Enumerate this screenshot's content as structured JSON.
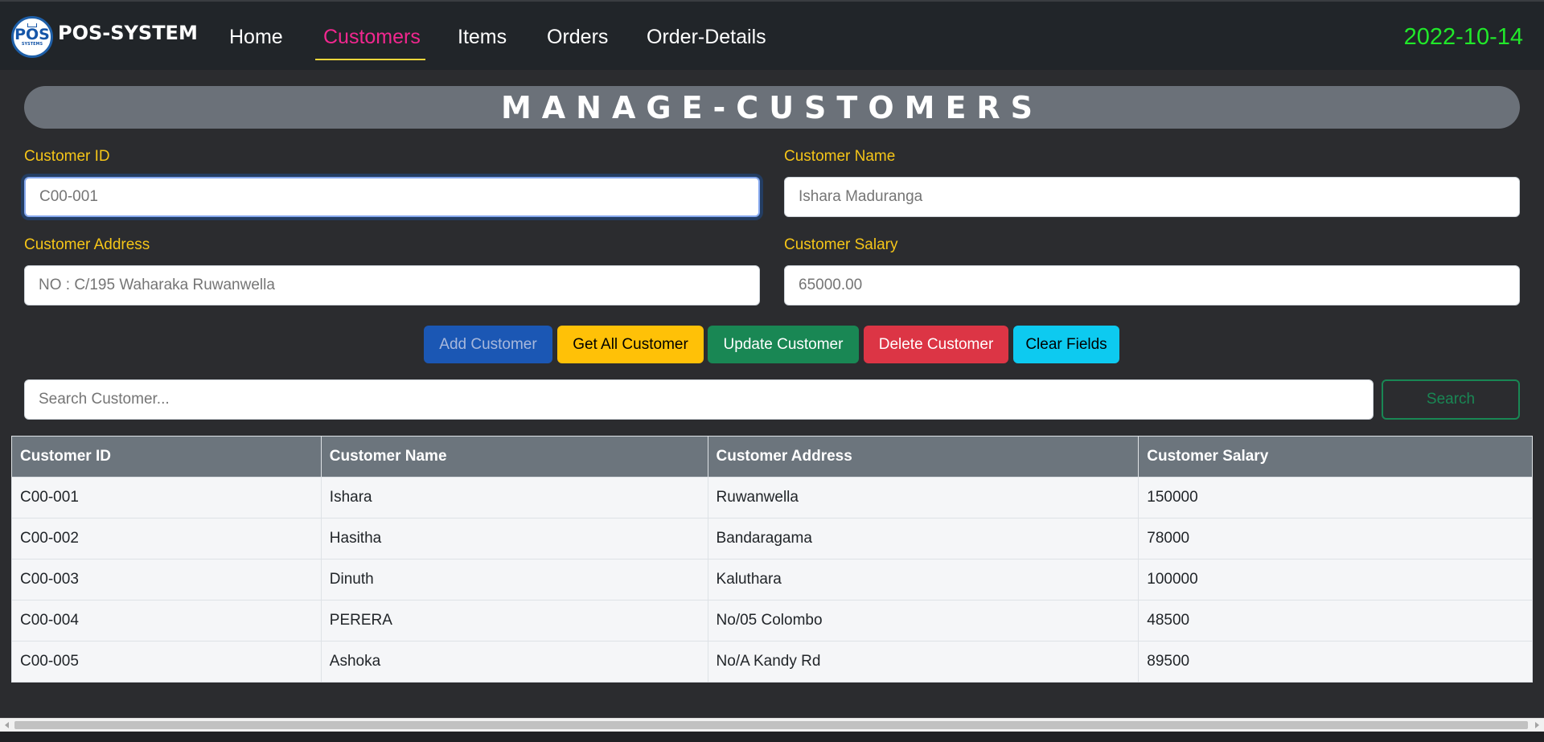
{
  "navbar": {
    "logo": {
      "text": "POS",
      "subtext": "SYSTEMS",
      "icon": "pos-logo-icon"
    },
    "brand": "POS-SYSTEM",
    "links": [
      "Home",
      "Customers",
      "Items",
      "Orders",
      "Order-Details"
    ],
    "active_link": "Customers",
    "date": "2022-10-14"
  },
  "title": "MANAGE-CUSTOMERS",
  "form": {
    "customer_id": {
      "label": "Customer ID",
      "placeholder": "C00-001"
    },
    "customer_name": {
      "label": "Customer Name",
      "placeholder": "Ishara Maduranga"
    },
    "customer_address": {
      "label": "Customer Address",
      "placeholder": "NO : C/195 Waharaka Ruwanwella"
    },
    "customer_salary": {
      "label": "Customer Salary",
      "placeholder": "65000.00"
    }
  },
  "buttons": {
    "add": "Add Customer",
    "get_all": "Get All Customer",
    "update": "Update Customer",
    "delete": "Delete Customer",
    "clear": "Clear Fields"
  },
  "search": {
    "placeholder": "Search Customer...",
    "button": "Search"
  },
  "table": {
    "headers": [
      "Customer ID",
      "Customer Name",
      "Customer Address",
      "Customer Salary"
    ],
    "rows": [
      [
        "C00-001",
        "Ishara",
        "Ruwanwella",
        "150000"
      ],
      [
        "C00-002",
        "Hasitha",
        "Bandaragama",
        "78000"
      ],
      [
        "C00-003",
        "Dinuth",
        "Kaluthara",
        "100000"
      ],
      [
        "C00-004",
        "PERERA",
        "No/05 Colombo",
        "48500"
      ],
      [
        "C00-005",
        "Ashoka",
        "No/A Kandy Rd",
        "89500"
      ]
    ]
  },
  "colors": {
    "navbar_bg": "#212529",
    "page_bg": "#2b2c2f",
    "active_link": "#f2278f",
    "date": "#21e82a",
    "label": "#f5c518",
    "banner": "#6b7179"
  }
}
